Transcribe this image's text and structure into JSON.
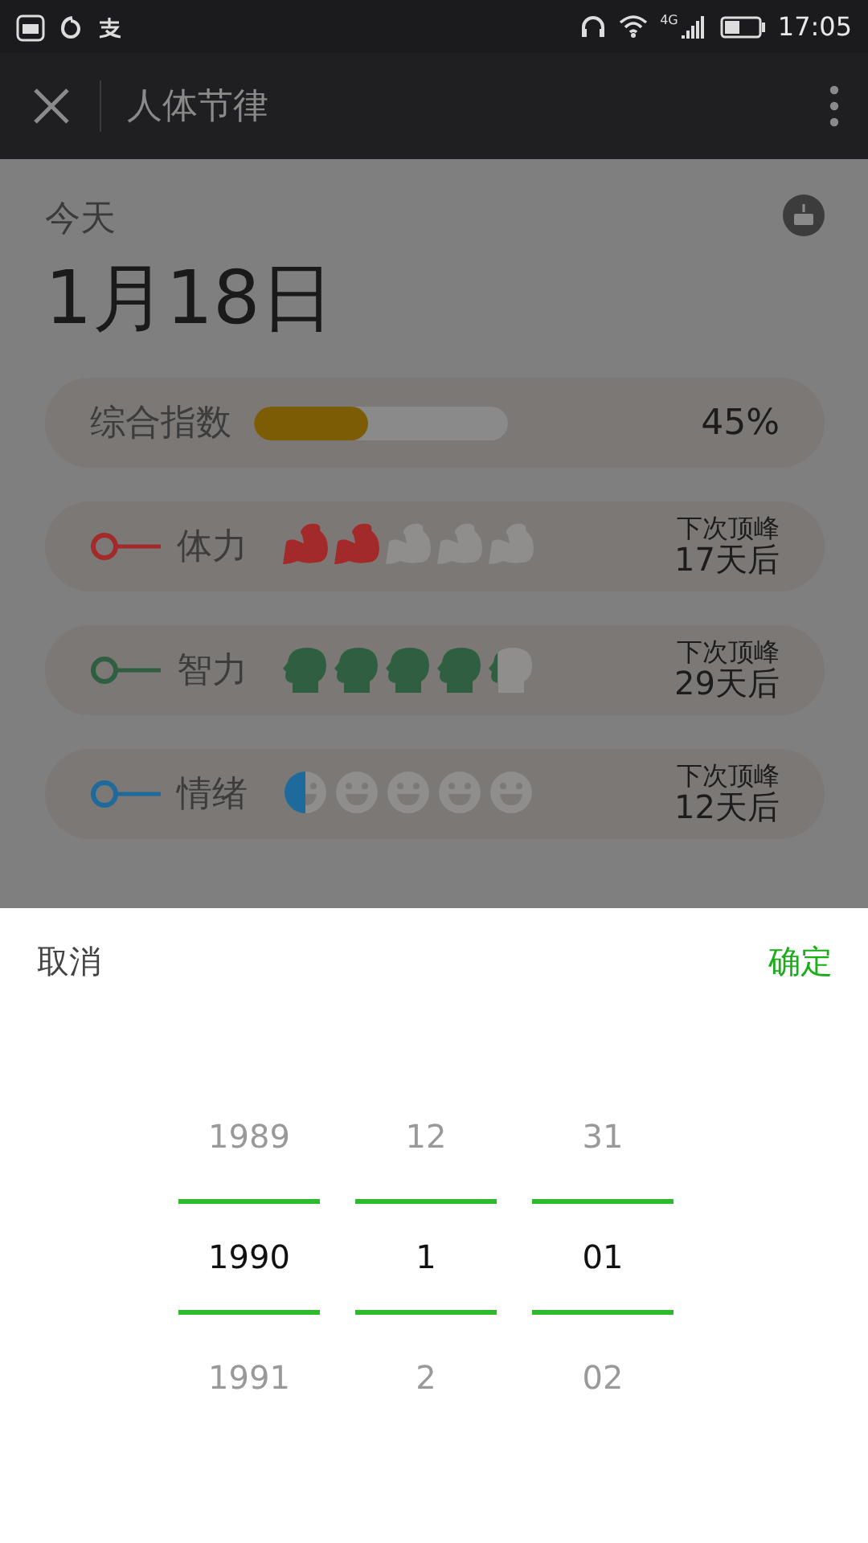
{
  "status_bar": {
    "network": "4G",
    "time": "17:05"
  },
  "header": {
    "title": "人体节律"
  },
  "today": {
    "label": "今天",
    "date": "1月18日"
  },
  "overall": {
    "label": "综合指数",
    "level": 0.45,
    "reading": "45%"
  },
  "rhythms": [
    {
      "kind": "muscle",
      "name": "体力",
      "color": "#a32a2a",
      "stars": 2,
      "next_label": "下次顶峰",
      "next_value": "17天后"
    },
    {
      "kind": "head",
      "name": "智力",
      "color": "#2f5e40",
      "stars": 4.2,
      "next_label": "下次顶峰",
      "next_value": "29天后"
    },
    {
      "kind": "smile",
      "name": "情绪",
      "color": "#1f6a9c",
      "stars": 0.5,
      "next_label": "下次顶峰",
      "next_value": "12天后"
    }
  ],
  "picker": {
    "cancel": "取消",
    "confirm": "确定",
    "columns": [
      {
        "items": [
          {
            "label": "1989",
            "selected": false
          },
          {
            "label": "1990",
            "selected": true
          },
          {
            "label": "1991",
            "selected": false
          }
        ]
      },
      {
        "items": [
          {
            "label": "12",
            "selected": false
          },
          {
            "label": "1",
            "selected": true
          },
          {
            "label": "2",
            "selected": false
          }
        ]
      },
      {
        "items": [
          {
            "label": "31",
            "selected": false
          },
          {
            "label": "01",
            "selected": true
          },
          {
            "label": "02",
            "selected": false
          }
        ]
      }
    ]
  }
}
